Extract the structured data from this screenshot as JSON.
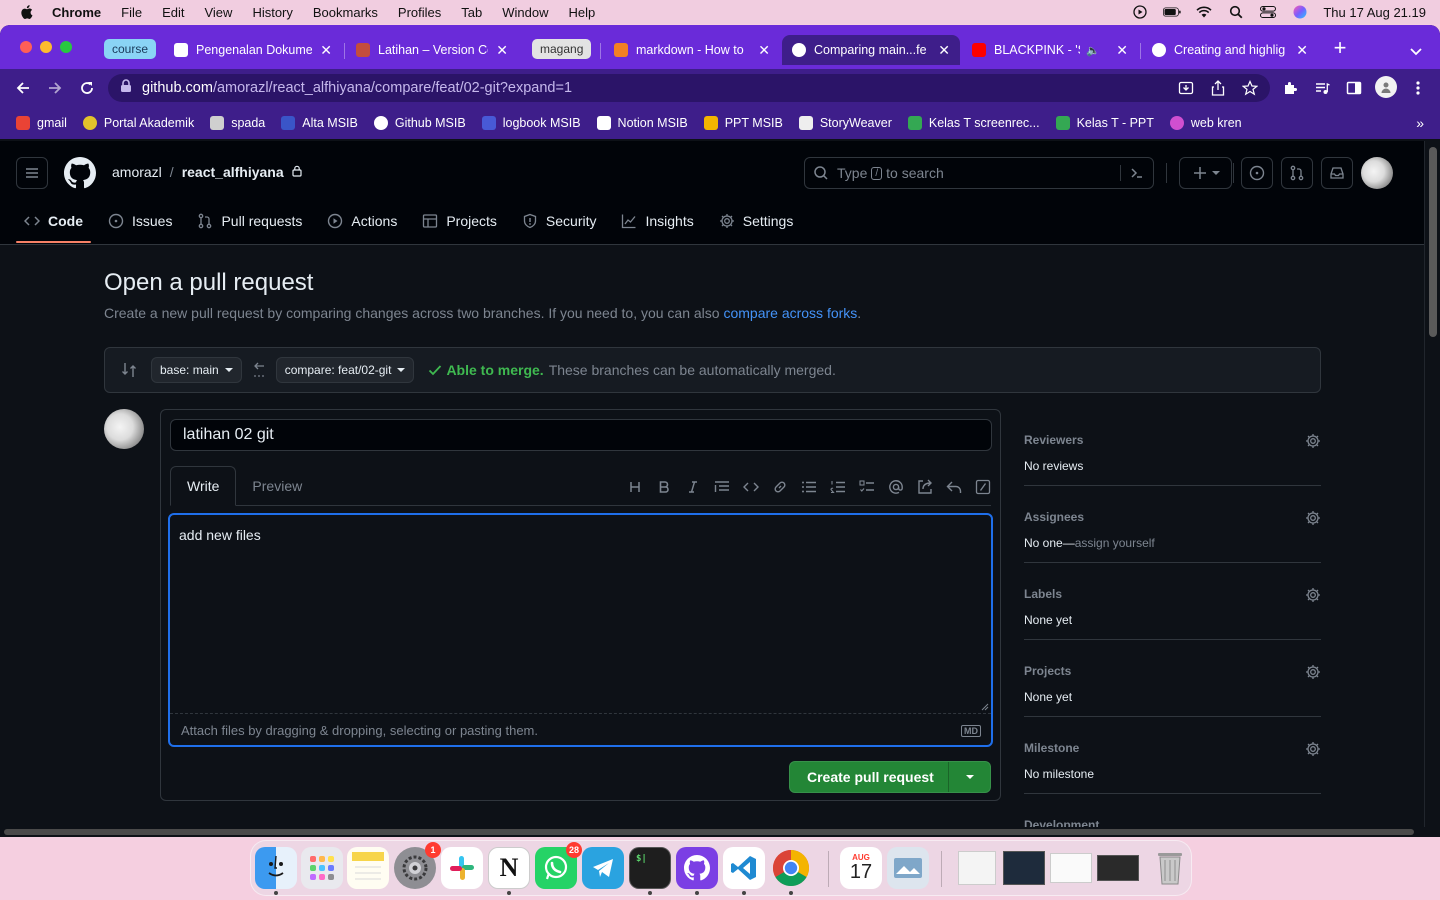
{
  "menubar": {
    "app": "Chrome",
    "items": [
      "File",
      "Edit",
      "View",
      "History",
      "Bookmarks",
      "Profiles",
      "Tab",
      "Window",
      "Help"
    ],
    "clock": "Thu 17 Aug  21.19"
  },
  "tabs": {
    "groups": [
      {
        "label": "course",
        "color": "#8ad4f5"
      },
      {
        "label": "magang",
        "color": "#e3e3e3"
      }
    ],
    "items": [
      {
        "label": "Pengenalan Dokume",
        "icon": "page-icon",
        "active": false
      },
      {
        "label": "Latihan – Version Co",
        "icon": "page-icon",
        "active": false
      },
      {
        "label": "markdown - How to",
        "icon": "stackoverflow-icon",
        "active": false
      },
      {
        "label": "Comparing main...fe",
        "icon": "github-icon",
        "active": true
      },
      {
        "label": "BLACKPINK - 'S",
        "icon": "youtube-icon",
        "active": false
      },
      {
        "label": "Creating and highlig",
        "icon": "github-icon",
        "active": false
      }
    ],
    "new_tab": "+"
  },
  "address": {
    "host": "github.com",
    "path": "/amorazl/react_alfhiyana/compare/feat/02-git?expand=1"
  },
  "bookmarks": [
    {
      "label": "gmail",
      "color": "#ea4335"
    },
    {
      "label": "Portal Akademik",
      "color": "#e2c22b"
    },
    {
      "label": "spada",
      "color": "#cfcfcf"
    },
    {
      "label": "Alta MSIB",
      "color": "#3a55c8"
    },
    {
      "label": "Github MSIB",
      "color": "#ffffff"
    },
    {
      "label": "logbook MSIB",
      "color": "#4859d6"
    },
    {
      "label": "Notion MSIB",
      "color": "#ffffff"
    },
    {
      "label": "PPT MSIB",
      "color": "#f4b400"
    },
    {
      "label": "StoryWeaver",
      "color": "#eeeeee"
    },
    {
      "label": "Kelas T screenrec...",
      "color": "#34a853"
    },
    {
      "label": "Kelas T - PPT",
      "color": "#34a853"
    },
    {
      "label": "web kren",
      "color": "#d04fd0"
    }
  ],
  "github": {
    "owner": "amorazl",
    "separator": "/",
    "repo": "react_alfhiyana",
    "search_placeholder_pre": "Type",
    "search_slash": "/",
    "search_placeholder_post": "to search",
    "nav": [
      {
        "label": "Code",
        "icon": "code-icon",
        "active": true
      },
      {
        "label": "Issues",
        "icon": "issue-icon",
        "active": false
      },
      {
        "label": "Pull requests",
        "icon": "pull-request-icon",
        "active": false
      },
      {
        "label": "Actions",
        "icon": "play-icon",
        "active": false
      },
      {
        "label": "Projects",
        "icon": "table-icon",
        "active": false
      },
      {
        "label": "Security",
        "icon": "shield-icon",
        "active": false
      },
      {
        "label": "Insights",
        "icon": "graph-icon",
        "active": false
      },
      {
        "label": "Settings",
        "icon": "gear-icon",
        "active": false
      }
    ]
  },
  "page": {
    "title": "Open a pull request",
    "description": "Create a new pull request by comparing changes across two branches. If you need to, you can also",
    "forks_link": "compare across forks",
    "description_end": "."
  },
  "range": {
    "base": "base: main",
    "compare": "compare: feat/02-git",
    "merge_status": "Able to merge.",
    "merge_note": "These branches can be automatically merged."
  },
  "composer": {
    "title_value": "latihan 02 git",
    "tab_write": "Write",
    "tab_preview": "Preview",
    "body": "add new files",
    "attach_hint": "Attach files by dragging & dropping, selecting or pasting them.",
    "markdown_badge": "MD",
    "submit": "Create pull request"
  },
  "sidebar": [
    {
      "heading": "Reviewers",
      "value": "No reviews",
      "sub": ""
    },
    {
      "heading": "Assignees",
      "value": "No one—",
      "sub": "assign yourself"
    },
    {
      "heading": "Labels",
      "value": "None yet",
      "sub": ""
    },
    {
      "heading": "Projects",
      "value": "None yet",
      "sub": ""
    },
    {
      "heading": "Milestone",
      "value": "No milestone",
      "sub": ""
    },
    {
      "heading": "Development",
      "value": "",
      "sub": ""
    }
  ],
  "dock": {
    "apps": [
      {
        "name": "Finder",
        "color": "#3c9af0",
        "running": true
      },
      {
        "name": "Launchpad",
        "color": "#e9e9ee",
        "running": false
      },
      {
        "name": "Notes",
        "color": "#f7d54a",
        "running": false
      },
      {
        "name": "System Settings",
        "color": "#8e8e93",
        "running": false,
        "badge": "1"
      },
      {
        "name": "Slack",
        "color": "#ffffff",
        "running": false
      },
      {
        "name": "Notion",
        "color": "#ffffff",
        "running": true
      },
      {
        "name": "WhatsApp",
        "color": "#25d366",
        "running": false,
        "badge": "28"
      },
      {
        "name": "Telegram",
        "color": "#2aa3e0",
        "running": false
      },
      {
        "name": "Terminal",
        "color": "#1e1e1e",
        "running": true
      },
      {
        "name": "GitHub Desktop",
        "color": "#7b3fe4",
        "running": true
      },
      {
        "name": "VS Code",
        "color": "#ffffff",
        "running": true
      },
      {
        "name": "Chrome",
        "color": "#ffffff",
        "running": true
      },
      {
        "name": "Calendar",
        "color": "#ffffff",
        "running": false,
        "month": "AUG",
        "day": "17"
      },
      {
        "name": "Preview",
        "color": "#dde5ee",
        "running": false
      }
    ]
  }
}
